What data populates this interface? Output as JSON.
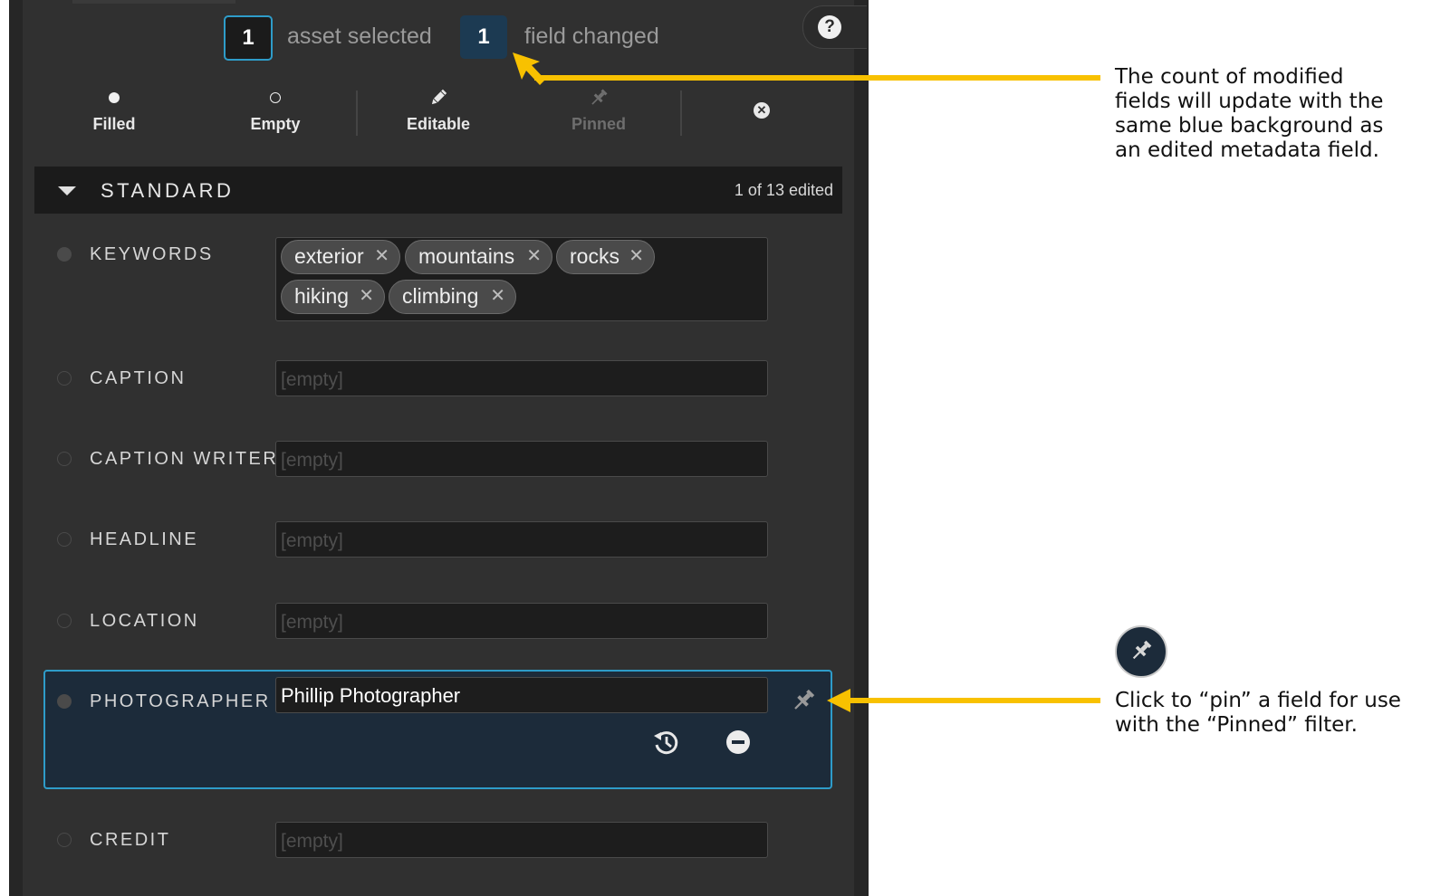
{
  "header": {
    "assets_count": "1",
    "assets_label": "asset selected",
    "fields_count": "1",
    "fields_label": "field changed",
    "help_glyph": "?"
  },
  "filters": [
    {
      "label": "Filled",
      "icon": "filled-dot-icon",
      "enabled": true
    },
    {
      "label": "Empty",
      "icon": "empty-dot-icon",
      "enabled": true
    },
    {
      "label": "Editable",
      "icon": "pencil-icon",
      "enabled": true
    },
    {
      "label": "Pinned",
      "icon": "pin-icon",
      "enabled": false
    }
  ],
  "clear_glyph": "✕",
  "section": {
    "title": "STANDARD",
    "edited_count": "1 of 13 edited"
  },
  "fields": {
    "keywords": {
      "label": "KEYWORDS",
      "chips": [
        "exterior",
        "mountains",
        "rocks",
        "hiking",
        "climbing"
      ],
      "chip_remove": "✕"
    },
    "caption": {
      "label": "CAPTION",
      "placeholder": "[empty]"
    },
    "caption_writer": {
      "label": "CAPTION WRITER",
      "placeholder": "[empty]"
    },
    "headline": {
      "label": "HEADLINE",
      "placeholder": "[empty]"
    },
    "location": {
      "label": "LOCATION",
      "placeholder": "[empty]"
    },
    "photographer": {
      "label": "PHOTOGRAPHER",
      "value": "Phillip Photographer"
    },
    "credit": {
      "label": "CREDIT",
      "placeholder": "[empty]"
    }
  },
  "annotations": {
    "count_note": [
      "The count of modified",
      "fields will update with the",
      "same blue background as",
      "an edited metadata field."
    ],
    "pin_note": [
      "Click to “pin” a field for use",
      "with the “Pinned” filter."
    ]
  },
  "colors": {
    "accent": "#2e9cc9",
    "edited_bg": "#1c2b3a",
    "arrow": "#f8c100",
    "panel": "#303030"
  }
}
